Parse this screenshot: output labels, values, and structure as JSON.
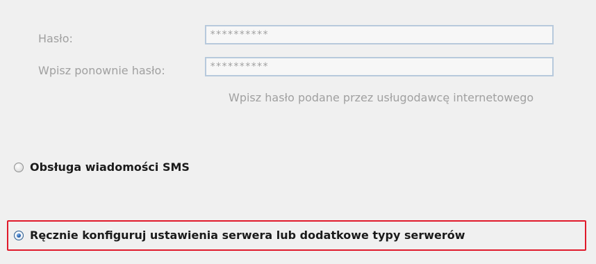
{
  "password": {
    "label": "Hasło:",
    "value": "**********"
  },
  "confirm_password": {
    "label": "Wpisz ponownie hasło:",
    "value": "**********"
  },
  "hint": "Wpisz hasło podane przez usługodawcę internetowego",
  "options": {
    "sms": {
      "label": "Obsługa wiadomości SMS",
      "selected": false
    },
    "manual": {
      "label": "Ręcznie konfiguruj ustawienia serwera lub dodatkowe typy serwerów",
      "selected": true
    }
  },
  "colors": {
    "highlight_border": "#e0192a",
    "field_border": "#b7c9dc",
    "disabled_text": "#a0a0a0"
  }
}
